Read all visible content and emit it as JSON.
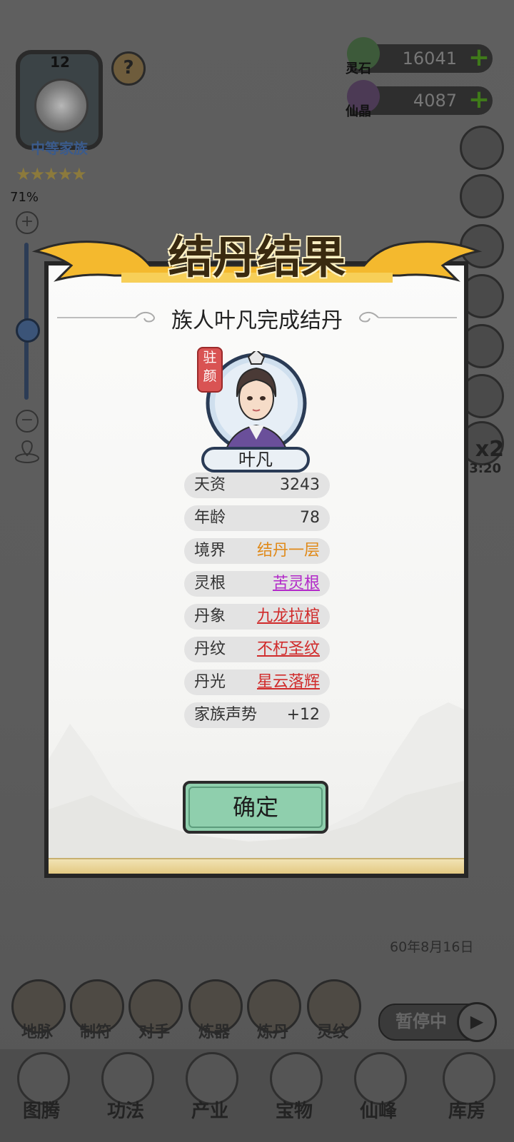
{
  "family": {
    "level": "12",
    "name": "中等家族",
    "stars": 5,
    "help": "?"
  },
  "zoom": {
    "percent": "71%",
    "plus": "+",
    "minus": "−",
    "level": 0.45
  },
  "currency": {
    "spirit_stone": {
      "label": "灵石",
      "value": "16041",
      "add": "+"
    },
    "immortal_crystal": {
      "label": "仙晶",
      "value": "4087",
      "add": "+"
    }
  },
  "speed": {
    "multiplier": "x2",
    "timer": "3:20"
  },
  "dialog": {
    "title": "结丹结果",
    "subtitle": "族人叶凡完成结丹",
    "seal": "驻颜",
    "character_name": "叶凡",
    "stats": [
      {
        "key": "天资",
        "value": "3243",
        "style": "plain"
      },
      {
        "key": "年龄",
        "value": "78",
        "style": "plain"
      },
      {
        "key": "境界",
        "value": "结丹一层",
        "style": "gold"
      },
      {
        "key": "灵根",
        "value": "苦灵根",
        "style": "purple"
      },
      {
        "key": "丹象",
        "value": "九龙拉棺",
        "style": "red"
      },
      {
        "key": "丹纹",
        "value": "不朽圣纹",
        "style": "red"
      },
      {
        "key": "丹光",
        "value": "星云落辉",
        "style": "red"
      },
      {
        "key": "家族声势",
        "value": "+12",
        "style": "plain"
      }
    ],
    "confirm": "确定"
  },
  "date": "60年8月16日",
  "pause": {
    "label": "暂停中",
    "play": "▶"
  },
  "function_row": [
    "地脉",
    "制符",
    "对手",
    "炼器",
    "炼丹",
    "灵纹"
  ],
  "bottom_nav": [
    "图腾",
    "功法",
    "产业",
    "宝物",
    "仙峰",
    "库房"
  ],
  "colors": {
    "confirm_bg": "#8fcfad",
    "realm": "#e08a1a",
    "root": "#b228c9",
    "rare": "#d02a2a",
    "banner": "#f4b92e"
  }
}
